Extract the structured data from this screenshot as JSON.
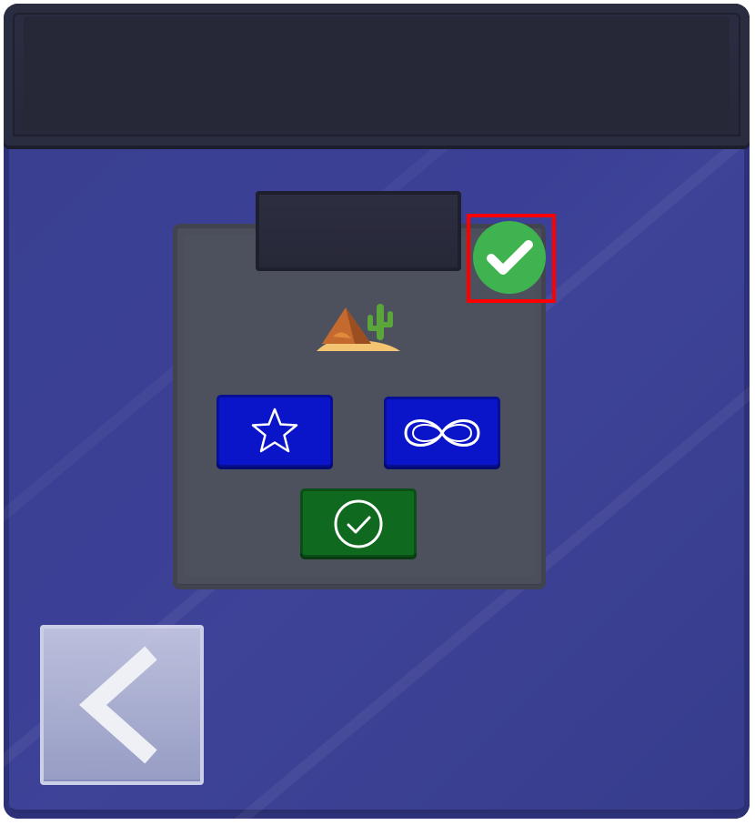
{
  "header": {
    "title": ""
  },
  "level": {
    "label": "",
    "theme_icon": "desert-cactus-icon",
    "completed": true
  },
  "modes": [
    {
      "name": "star-mode",
      "icon": "star-outline-icon",
      "color": "#0a14c8"
    },
    {
      "name": "endless-mode",
      "icon": "infinity-icon",
      "color": "#0a14c8"
    },
    {
      "name": "completed-mode",
      "icon": "circle-check-icon",
      "color": "#0f6a1f"
    }
  ],
  "navigation": {
    "back_icon": "chevron-left-icon"
  },
  "colors": {
    "panel": "#3a3f90",
    "header": "#262838",
    "card": "#4b4f5c",
    "badge_green": "#3fb34f",
    "highlight": "#ff0000"
  }
}
